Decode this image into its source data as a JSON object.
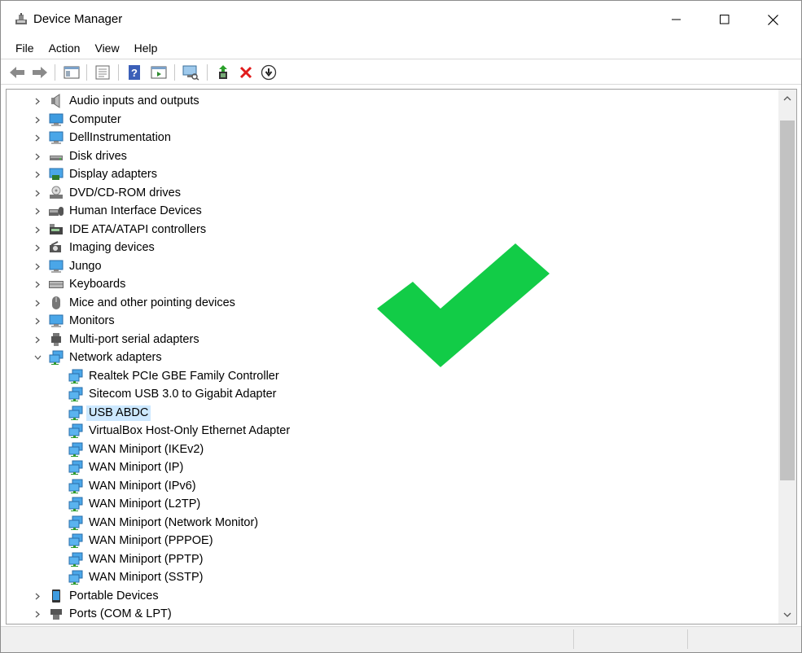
{
  "window": {
    "title": "Device Manager"
  },
  "menu": [
    "File",
    "Action",
    "View",
    "Help"
  ],
  "toolbar": [
    "back-icon",
    "forward-icon",
    "show-hide-console-tree-icon",
    "properties-icon",
    "help-icon",
    "action-pane-icon",
    "scan-hardware-icon",
    "update-driver-icon",
    "uninstall-icon",
    "disable-device-icon"
  ],
  "tree": {
    "categories_top": [
      {
        "label": "Audio inputs and outputs",
        "icon": "speaker-icon"
      },
      {
        "label": "Computer",
        "icon": "computer-icon"
      },
      {
        "label": "DellInstrumentation",
        "icon": "monitor-icon"
      },
      {
        "label": "Disk drives",
        "icon": "disk-drive-icon"
      },
      {
        "label": "Display adapters",
        "icon": "display-adapter-icon"
      },
      {
        "label": "DVD/CD-ROM drives",
        "icon": "dvd-drive-icon"
      },
      {
        "label": "Human Interface Devices",
        "icon": "hid-icon"
      },
      {
        "label": "IDE ATA/ATAPI controllers",
        "icon": "ide-controller-icon"
      },
      {
        "label": "Imaging devices",
        "icon": "camera-icon"
      },
      {
        "label": "Jungo",
        "icon": "monitor-icon"
      },
      {
        "label": "Keyboards",
        "icon": "keyboard-icon"
      },
      {
        "label": "Mice and other pointing devices",
        "icon": "mouse-icon"
      },
      {
        "label": "Monitors",
        "icon": "monitor-icon"
      },
      {
        "label": "Multi-port serial adapters",
        "icon": "serial-adapter-icon"
      }
    ],
    "expanded": {
      "label": "Network adapters",
      "icon": "network-adapter-icon"
    },
    "network_children": [
      {
        "label": "Realtek PCIe GBE Family Controller"
      },
      {
        "label": "Sitecom USB 3.0 to Gigabit Adapter"
      },
      {
        "label": "USB ABDC",
        "selected": true
      },
      {
        "label": "VirtualBox Host-Only Ethernet Adapter"
      },
      {
        "label": "WAN Miniport (IKEv2)"
      },
      {
        "label": "WAN Miniport (IP)"
      },
      {
        "label": "WAN Miniport (IPv6)"
      },
      {
        "label": "WAN Miniport (L2TP)"
      },
      {
        "label": "WAN Miniport (Network Monitor)"
      },
      {
        "label": "WAN Miniport (PPPOE)"
      },
      {
        "label": "WAN Miniport (PPTP)"
      },
      {
        "label": "WAN Miniport (SSTP)"
      }
    ],
    "categories_bottom": [
      {
        "label": "Portable Devices",
        "icon": "portable-device-icon"
      },
      {
        "label": "Ports (COM & LPT)",
        "icon": "port-icon"
      }
    ]
  },
  "colors": {
    "selection": "#cce8ff",
    "checkmark": "#12cc47",
    "accent": "#2d9ad9"
  }
}
